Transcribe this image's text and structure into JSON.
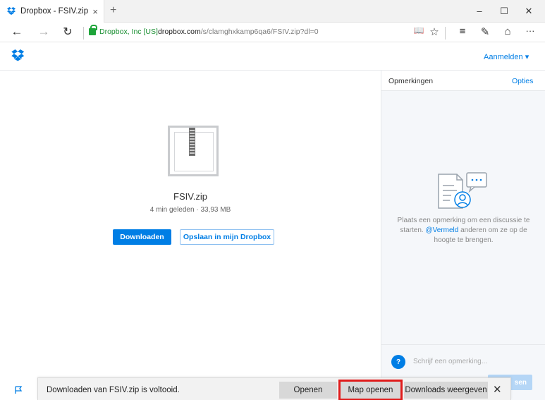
{
  "browser": {
    "tab_title": "Dropbox - FSIV.zip",
    "tab_close": "×",
    "new_tab": "+",
    "window_controls": {
      "minimize": "–",
      "maximize": "☐",
      "close": "✕"
    },
    "nav": {
      "back": "←",
      "forward": "→",
      "refresh": "↻"
    },
    "cert_label": "Dropbox, Inc [US]",
    "url_domain": "dropbox.com",
    "url_path": "/s/clamghxkamp6qa6/FSIV.zip?dl=0",
    "tools": {
      "reading": "📖",
      "favorite": "☆",
      "hub": "≡",
      "notes": "✎",
      "share": "⌂",
      "more": "···"
    }
  },
  "header": {
    "logo_icon": "dropbox-logo",
    "signin_label": "Aanmelden ▾"
  },
  "preview": {
    "file_icon": "zip-file-icon",
    "filename": "FSIV.zip",
    "meta": "4 min geleden · 33,93 MB",
    "download_label": "Downloaden",
    "save_label": "Opslaan in mijn Dropbox"
  },
  "comments": {
    "title": "Opmerkingen",
    "options_label": "Opties",
    "empty_text_before": "Plaats een opmerking om een discussie te starten. ",
    "empty_mention": "@Vermeld",
    "empty_text_after": " anderen om ze op de hoogte te brengen.",
    "avatar_letter": "?",
    "input_placeholder": "Schrijf een opmerking...",
    "send_label": "sen"
  },
  "download_bar": {
    "message": "Downloaden van FSIV.zip is voltooid.",
    "open_label": "Openen",
    "open_folder_label": "Map openen",
    "view_downloads_label": "Downloads weergeven",
    "close_label": "✕",
    "highlight_color": "#e01b1b"
  },
  "colors": {
    "accent": "#007ee5",
    "cert_green": "#1a8f32"
  }
}
